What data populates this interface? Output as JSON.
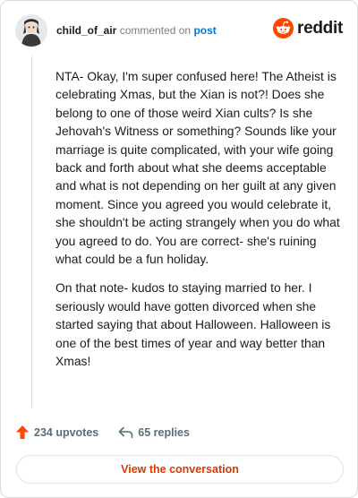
{
  "header": {
    "username": "child_of_air",
    "action_text": "commented on",
    "post_link": "post",
    "brand_name": "reddit"
  },
  "comment": {
    "paragraphs": [
      "NTA- Okay, I'm super confused here! The Atheist is celebrating Xmas, but the Xian is not?! Does she belong to one of those weird Xian cults? Is she Jehovah's Witness or something? Sounds like your marriage is quite complicated, with your wife going back and forth about what she deems acceptable and what is not depending on her guilt at any given moment. Since you agreed you would celebrate it, she shouldn't be acting strangely when you do what you agreed to do. You are correct- she's ruining what could be a fun holiday.",
      "On that note- kudos to staying married to her. I seriously would have gotten divorced when she started saying that about Halloween. Halloween is one of the best times of year and way better than Xmas!"
    ]
  },
  "actions": {
    "upvotes": "234 upvotes",
    "replies": "65 replies"
  },
  "footer": {
    "view_label": "View the conversation"
  },
  "colors": {
    "brand_orange": "#ff4500",
    "link_blue": "#0079d3",
    "cta_text": "#d93a00"
  },
  "icons": {
    "avatar": "user-avatar",
    "brand": "reddit-snoo-icon",
    "upvote": "upvote-arrow-icon",
    "reply": "reply-arrow-icon"
  }
}
